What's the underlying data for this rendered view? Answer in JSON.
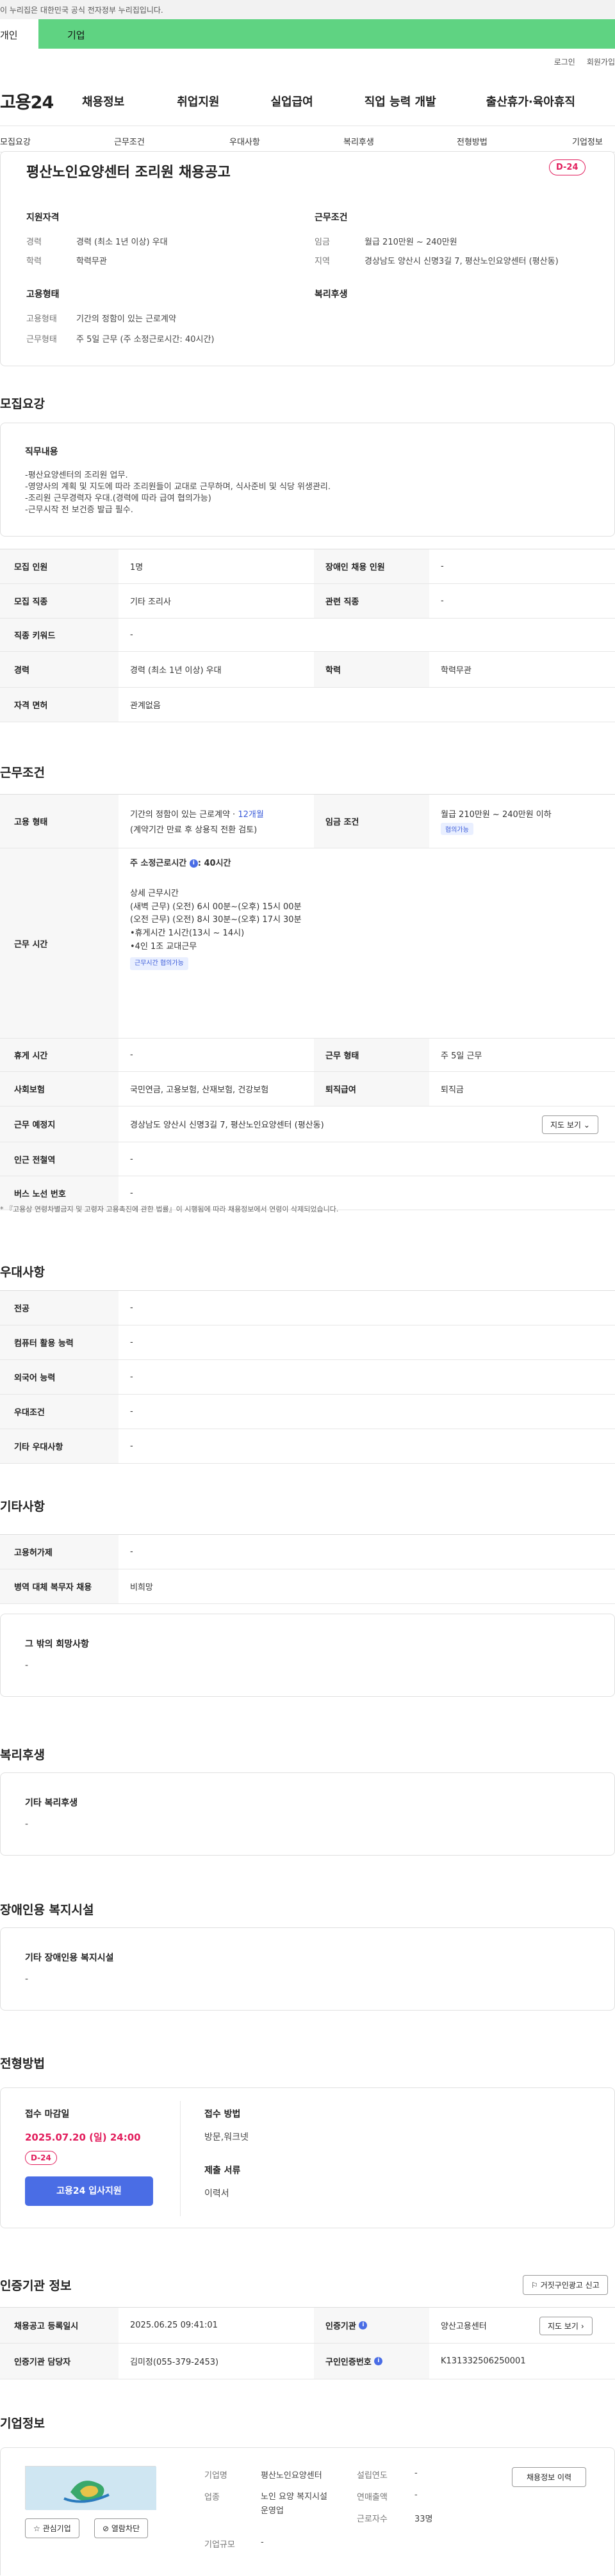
{
  "gov_banner": "이 누리집은 대한민국 공식 전자정부 누리집입니다.",
  "type_tabs": [
    "개인",
    "기업"
  ],
  "util": [
    "로그인",
    "회원가입"
  ],
  "logo": "고용24",
  "gnb": [
    "채용정보",
    "취업지원",
    "실업급여",
    "직업 능력 개발",
    "출산휴가·육아휴직"
  ],
  "tabs": [
    "모집요강",
    "근무조건",
    "우대사항",
    "복리후생",
    "전형방법",
    "기업정보"
  ],
  "summary": {
    "title": "평산노인요양센터 조리원 채용공고",
    "dday": "D-24",
    "qual_title": "지원자격",
    "career_label": "경력",
    "career": "경력 (최소 1년 이상) 우대",
    "edu_label": "학력",
    "edu": "학력무관",
    "cond_title": "근무조건",
    "wage_label": "임금",
    "wage": "월급 210만원 ~ 240만원",
    "region_label": "지역",
    "region": "경상남도 양산시 신명3길 7, 평산노인요양센터 (평산동)",
    "emp_title": "고용형태",
    "emp_label": "고용형태",
    "emp": "기간의 정함이 있는 근로계약",
    "work_label": "근무형태",
    "work": "주 5일 근무 (주 소정근로시간: 40시간)",
    "welfare_title": "복리후생"
  },
  "recruit": {
    "title": "모집요강",
    "duty_title": "직무내용",
    "duty_lines": [
      "-평산요양센터의 조리원 업무.",
      "-영양사의 계획 및 지도에 따라 조리원들이 교대로 근무하며, 식사준비 및 식당 위생관리.",
      "-조리원 근무경력자 우대.(경력에 따라 급여 협의가능)",
      "-근무시작 전 보건증 발급 필수."
    ],
    "headcount_label": "모집 인원",
    "headcount": "1명",
    "disabled_label": "장애인 채용 인원",
    "disabled": "-",
    "job_label": "모집 직종",
    "job": "기타 조리사",
    "rel_label": "관련 직종",
    "rel": "-",
    "kw_label": "직종 키워드",
    "kw": "-",
    "career_label": "경력",
    "career": "경력 (최소 1년 이상) 우대",
    "edu_label": "학력",
    "edu": "학력무관",
    "license_label": "자격 면허",
    "license": "관계없음"
  },
  "cond": {
    "title": "근무조건",
    "emp_label": "고용 형태",
    "emp1": "기간의 정함이 있는 근로계약 · ",
    "emp1_hl": "12개월",
    "emp2": "(계약기간 만료 후 상용직 전환 검토)",
    "wage_label": "임금 조건",
    "wage": "월급 210만원 ~ 240만원 이하",
    "wage_badge": "협의가능",
    "time_label": "근무 시간",
    "weekly": "주 소정근로시간",
    "weekly_val": ": 40시간",
    "detail_title": "상세 근무시간",
    "detail": [
      "(새벽 근무) (오전) 6시 00분~(오후) 15시 00분",
      "(오전 근무) (오전) 8시 30분~(오후) 17시 30분",
      "•휴게시간 1시간(13시 ~ 14시)",
      "•4인 1조 교대근무"
    ],
    "time_badge": "근무시간 협의가능",
    "rest_label": "휴게 시간",
    "rest": "-",
    "form_label": "근무 형태",
    "form": "주 5일 근무",
    "ins_label": "사회보험",
    "ins": "국민연금, 고용보험, 산재보험, 건강보험",
    "ret_label": "퇴직급여",
    "ret": "퇴직금",
    "place_label": "근무 예정지",
    "place": "경상남도 양산시 신명3길 7, 평산노인요양센터 (평산동)",
    "map_btn": "지도 보기",
    "subway_label": "인근 전철역",
    "subway": "-",
    "bus_label": "버스 노선 번호",
    "bus": "-",
    "note": "* 『고용상 연령차별금지 및 고령자 고용촉진에 관한 법률』이 시행됨에 따라 채용정보에서 연령이 삭제되었습니다."
  },
  "pref": {
    "title": "우대사항",
    "rows": [
      [
        "전공",
        "-"
      ],
      [
        "컴퓨터 활용 능력",
        "-"
      ],
      [
        "외국어 능력",
        "-"
      ],
      [
        "우대조건",
        "-"
      ],
      [
        "기타 우대사항",
        "-"
      ]
    ]
  },
  "etc": {
    "title": "기타사항",
    "rows": [
      [
        "고용허가제",
        "-"
      ],
      [
        "병역 대체 복무자 채용",
        "비희망"
      ]
    ],
    "other_title": "그 밖의 희망사항",
    "other": "-"
  },
  "welfare": {
    "title": "복리후생",
    "sub": "기타 복리후생",
    "val": "-"
  },
  "disab": {
    "title": "장애인용 복지시설",
    "sub": "기타 장애인용 복지시설",
    "val": "-"
  },
  "screen": {
    "title": "전형방법",
    "deadline_title": "접수 마감일",
    "deadline": "2025.07.20 (일) 24:00",
    "dday": "D-24",
    "apply": "고용24 입사지원",
    "method_title": "접수 방법",
    "method": "방문,워크넷",
    "docs_title": "제출 서류",
    "docs": "이력서"
  },
  "agency": {
    "title": "인증기관 정보",
    "report_btn": "거짓구인광고 신고",
    "reg_label": "채용공고 등록일시",
    "reg": "2025.06.25 09:41:01",
    "org_label": "인증기관",
    "org": "양산고용센터",
    "map_btn": "지도 보기",
    "mgr_label": "인증기관 담당자",
    "mgr": "김미정(055-379-2453)",
    "no_label": "구인인증번호",
    "no": "K131332506250001"
  },
  "company": {
    "title": "기업정보",
    "name_label": "기업명",
    "name": "평산노인요양센터",
    "year_label": "설립연도",
    "year": "-",
    "ind_label": "업종",
    "ind": "노인 요양 복지시설 운영업",
    "sales_label": "연매출액",
    "sales": "-",
    "emp_label": "근로자수",
    "emp": "33명",
    "size_label": "기업규모",
    "size": "-",
    "history_btn": "채용정보 이력",
    "fav_btn": "관심기업",
    "block_btn": "열람차단"
  }
}
